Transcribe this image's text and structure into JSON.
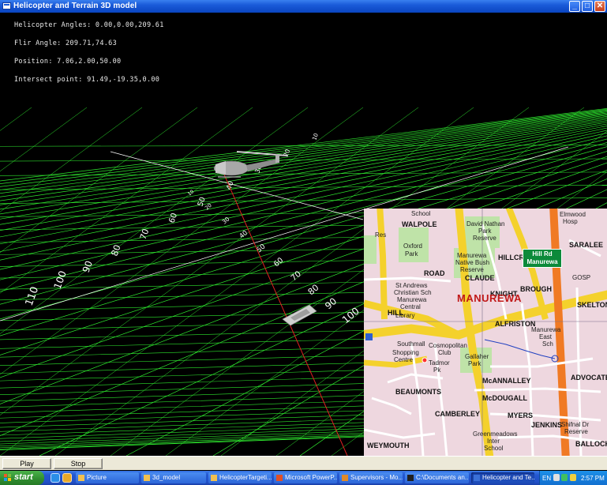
{
  "window": {
    "title": "Helicopter and Terrain 3D model",
    "controls": {
      "minimize": "_",
      "maximize": "□",
      "close": "✕"
    }
  },
  "hud": {
    "helicopter_angles": "Helicopter Angles: 0.00,0.00,209.61",
    "flir_angle": "Flir Angle: 209.71,74.63",
    "position": "Position: 7.06,2.00,50.00",
    "intersect_point": "Intersect point: 91.49,-19.35,0.00"
  },
  "scene": {
    "colors": {
      "grid": "#2ee82e",
      "laser": "#e02020",
      "track": "#ffffff"
    },
    "track_labels": [
      "10",
      "20",
      "30",
      "40",
      "50",
      "60",
      "70",
      "80",
      "90",
      "100"
    ],
    "track_labels_left": [
      "10",
      "20",
      "30",
      "40",
      "50",
      "60",
      "70",
      "80",
      "90",
      "100",
      "110"
    ]
  },
  "map": {
    "suburb": "MANUREWA",
    "sign_line1": "Hill Rd",
    "sign_line2": "Manurewa",
    "labels": {
      "school": "School",
      "res": "Res",
      "walpole": "WALPOLE",
      "david_nathan": "David Nathan",
      "park": "Park",
      "reserve": "Reserve",
      "oxford": "Oxford",
      "oxford_park": "Park",
      "native_bush": "Manurewa",
      "native_bush2": "Native Bush",
      "native_bush3": "Reserve",
      "elmwood": "Elmwood",
      "hosp": "Hosp",
      "saralee": "SARALEE",
      "st_andrews": "St Andrews",
      "christian": "Christian Sch",
      "manurewa_central": "Manurewa",
      "central": "Central",
      "library": "Library",
      "road1": "ROAD",
      "hill": "HILL",
      "alfriston": "ALFRISTON",
      "claude": "CLAUDE",
      "skelton": "SKELTON",
      "manurewa_east": "Manurewa",
      "east": "East",
      "sch": "Sch",
      "southmall": "Southmall",
      "shopping_centre": "Shopping",
      "centre": "Centre",
      "cosmopolitan": "Cosmopolitan",
      "club": "Club",
      "tadmor": "Tadmor",
      "pk": "Pk",
      "gallaher": "Gallaher",
      "gallaher_park": "Park",
      "mcannalley": "McANNALLEY",
      "mcdougall": "McDOUGALL",
      "myers": "MYERS",
      "jenkins": "JENKINS",
      "greenmeadows": "Greenmeadows",
      "inter": "Inter",
      "school2": "School",
      "shifnal": "Shifnal Dr",
      "reserve2": "Reserve",
      "beaumonts": "BEAUMONTS",
      "camberley": "CAMBERLEY",
      "weymouth": "WEYMOUTH",
      "ballock": "BALLOCK",
      "advocate": "ADVOCATE",
      "ngauruhoe": "GOSP",
      "knight": "KNIGHT",
      "brough": "BROUGH",
      "crest": "HILLCREST"
    }
  },
  "controls": {
    "play_label": "Play",
    "stop_label": "Stop"
  },
  "taskbar": {
    "start_label": "start",
    "tasks": [
      {
        "label": "Picture",
        "active": false
      },
      {
        "label": "3d_model",
        "active": false
      },
      {
        "label": "HelicopterTargeti...",
        "active": false
      },
      {
        "label": "Microsoft PowerP...",
        "active": false
      },
      {
        "label": "Supervisors - Mo...",
        "active": false
      },
      {
        "label": "C:\\Documents an...",
        "active": false
      },
      {
        "label": "Helicopter and Te...",
        "active": true
      }
    ],
    "language": "EN",
    "clock": "2:57 PM"
  }
}
